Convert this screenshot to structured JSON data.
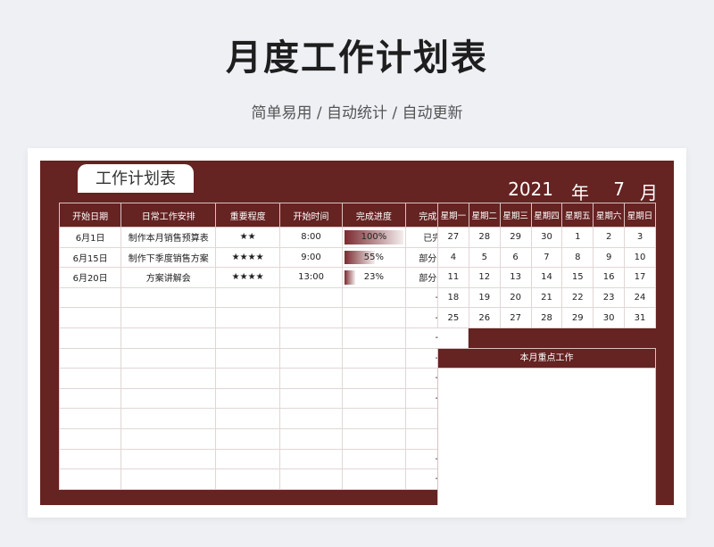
{
  "page": {
    "title": "月度工作计划表",
    "subtitle": "简单易用 / 自动统计 / 自动更新"
  },
  "sheet": {
    "tab_label": "工作计划表",
    "year": "2021",
    "year_unit": "年",
    "month": "7",
    "month_unit": "月"
  },
  "tasks": {
    "headers": [
      "开始日期",
      "日常工作安排",
      "重要程度",
      "开始时间",
      "完成进度",
      "完成状态"
    ],
    "rows": [
      {
        "date": "6月1日",
        "task": "制作本月销售预算表",
        "importance": "★★",
        "time": "8:00",
        "progress_label": "100%",
        "progress": 1.0,
        "status": "已完成"
      },
      {
        "date": "6月15日",
        "task": "制作下季度销售方案",
        "importance": "★★★★",
        "time": "9:00",
        "progress_label": "55%",
        "progress": 0.55,
        "status": "部分完成"
      },
      {
        "date": "6月20日",
        "task": "方案讲解会",
        "importance": "★★★★",
        "time": "13:00",
        "progress_label": "23%",
        "progress": 0.23,
        "status": "部分完成"
      },
      {
        "date": "",
        "task": "",
        "importance": "",
        "time": "",
        "progress_label": "",
        "progress": 0,
        "status": "-"
      },
      {
        "date": "",
        "task": "",
        "importance": "",
        "time": "",
        "progress_label": "",
        "progress": 0,
        "status": "-"
      },
      {
        "date": "",
        "task": "",
        "importance": "",
        "time": "",
        "progress_label": "",
        "progress": 0,
        "status": "-"
      },
      {
        "date": "",
        "task": "",
        "importance": "",
        "time": "",
        "progress_label": "",
        "progress": 0,
        "status": "-"
      },
      {
        "date": "",
        "task": "",
        "importance": "",
        "time": "",
        "progress_label": "",
        "progress": 0,
        "status": "-"
      },
      {
        "date": "",
        "task": "",
        "importance": "",
        "time": "",
        "progress_label": "",
        "progress": 0,
        "status": "-"
      },
      {
        "date": "",
        "task": "",
        "importance": "",
        "time": "",
        "progress_label": "",
        "progress": 0,
        "status": ""
      },
      {
        "date": "",
        "task": "",
        "importance": "",
        "time": "",
        "progress_label": "",
        "progress": 0,
        "status": ""
      },
      {
        "date": "",
        "task": "",
        "importance": "",
        "time": "",
        "progress_label": "",
        "progress": 0,
        "status": "-"
      },
      {
        "date": "",
        "task": "",
        "importance": "",
        "time": "",
        "progress_label": "",
        "progress": 0,
        "status": "-"
      }
    ]
  },
  "calendar": {
    "weekdays": [
      "星期一",
      "星期二",
      "星期三",
      "星期四",
      "星期五",
      "星期六",
      "星期日"
    ],
    "weeks": [
      [
        "27",
        "28",
        "29",
        "30",
        "1",
        "2",
        "3"
      ],
      [
        "4",
        "5",
        "6",
        "7",
        "8",
        "9",
        "10"
      ],
      [
        "11",
        "12",
        "13",
        "14",
        "15",
        "16",
        "17"
      ],
      [
        "18",
        "19",
        "20",
        "21",
        "22",
        "23",
        "24"
      ],
      [
        "25",
        "26",
        "27",
        "28",
        "29",
        "30",
        "31"
      ]
    ]
  },
  "focus": {
    "title": "本月重点工作"
  },
  "colors": {
    "accent": "#652322",
    "background": "#eef0f4",
    "progress_dark": "#7a2a2f"
  }
}
